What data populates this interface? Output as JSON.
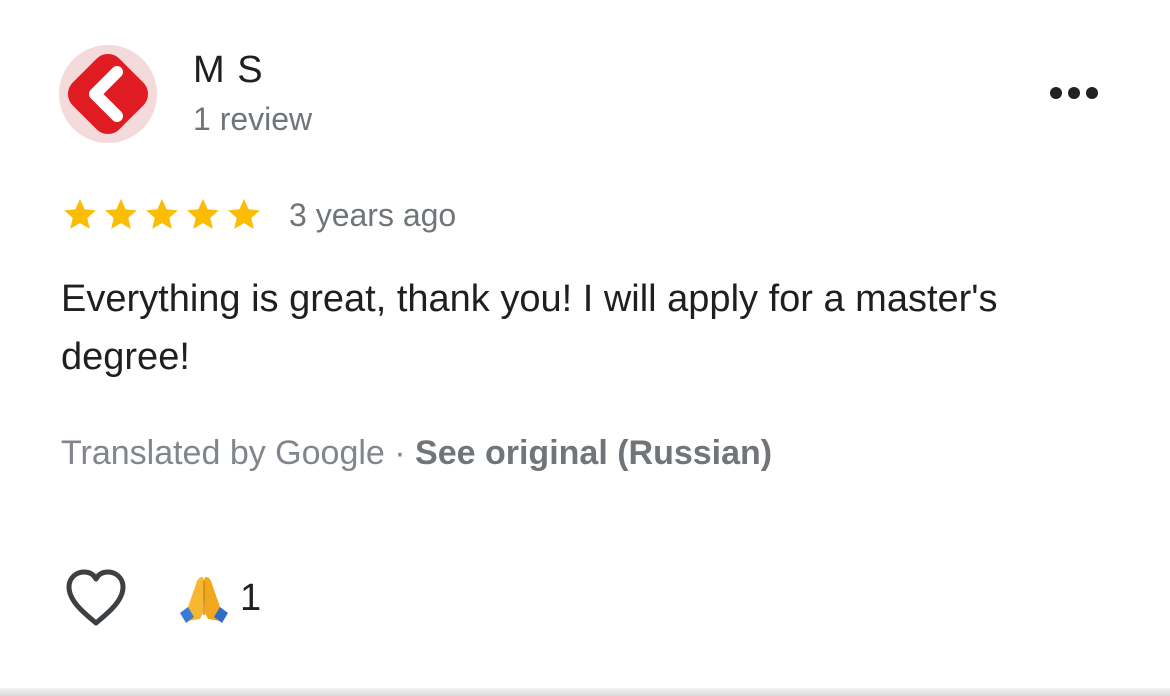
{
  "review": {
    "author": {
      "name": "M S",
      "review_count": "1 review",
      "avatar_icon": "red-arrow-left-logo"
    },
    "rating": 5,
    "rating_max": 5,
    "date": "3 years ago",
    "text": "Everything is great, thank you! I will apply for a master's degree!",
    "translation": {
      "prefix": "Translated by Google",
      "separator": " · ",
      "see_original": "See original (Russian)"
    },
    "reactions": {
      "like_icon": "heart-outline-icon",
      "emoji_icon": "folded-hands-emoji",
      "count": "1"
    },
    "more_icon": "more-horizontal-icon"
  },
  "colors": {
    "star": "#fbbc04",
    "avatar_red": "#e11b22",
    "secondary_text": "#70757a",
    "primary_text": "#1f1f1f"
  }
}
